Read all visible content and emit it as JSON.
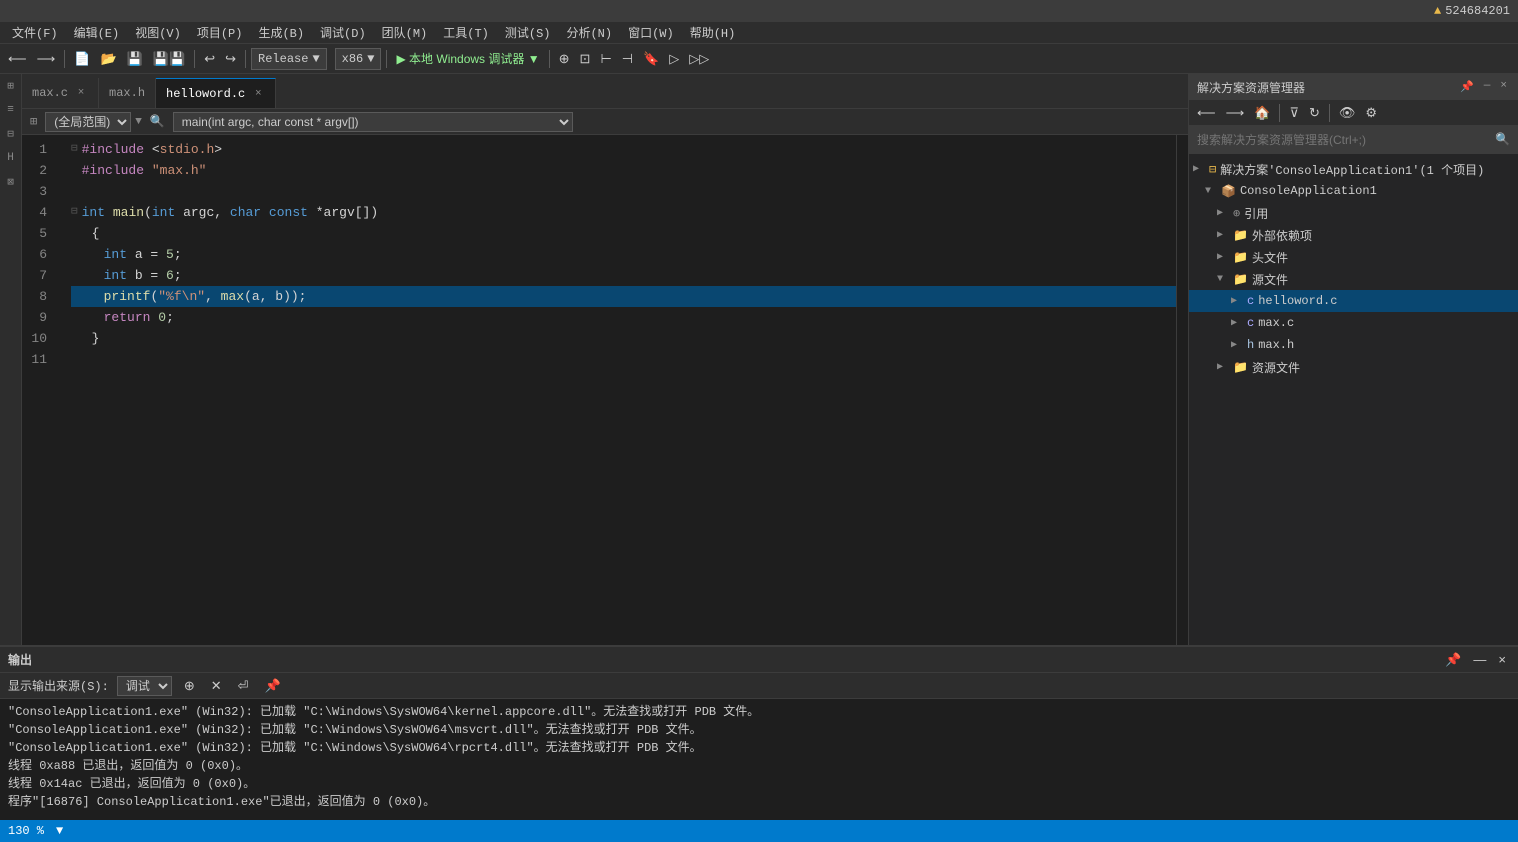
{
  "titlebar": {
    "warning": "▲",
    "id": "524684201"
  },
  "menubar": {
    "items": [
      "文件(F)",
      "编辑(E)",
      "视图(V)",
      "项目(P)",
      "生成(B)",
      "调试(D)",
      "团队(M)",
      "工具(T)",
      "测试(S)",
      "分析(N)",
      "窗口(W)",
      "帮助(H)"
    ]
  },
  "toolbar": {
    "config_label": "Release",
    "platform_label": "x86",
    "run_label": "▶ 本地 Windows 调试器 ▼"
  },
  "tabs": [
    {
      "label": "max.c",
      "active": false,
      "closable": true
    },
    {
      "label": "max.h",
      "active": false,
      "closable": false
    },
    {
      "label": "helloword.c",
      "active": true,
      "closable": true
    }
  ],
  "navbar": {
    "scope": "(全局范围)",
    "function": "main(int argc, char const * argv[])"
  },
  "code": {
    "lines": [
      {
        "num": 1,
        "content": "#include <stdio.h>",
        "type": "include"
      },
      {
        "num": 2,
        "content": "#include \"max.h\"",
        "type": "include"
      },
      {
        "num": 3,
        "content": "",
        "type": "empty"
      },
      {
        "num": 4,
        "content": "int main(int argc, char const *argv[])",
        "type": "func"
      },
      {
        "num": 5,
        "content": "{",
        "type": "normal"
      },
      {
        "num": 6,
        "content": "    int a = 5;",
        "type": "normal"
      },
      {
        "num": 7,
        "content": "    int b = 6;",
        "type": "normal"
      },
      {
        "num": 8,
        "content": "    printf(\"%f\\n\", max(a, b));",
        "type": "active"
      },
      {
        "num": 9,
        "content": "    return 0;",
        "type": "normal"
      },
      {
        "num": 10,
        "content": "}",
        "type": "normal"
      },
      {
        "num": 11,
        "content": "",
        "type": "empty"
      }
    ]
  },
  "solution_explorer": {
    "title": "解决方案资源管理器",
    "search_placeholder": "搜索解决方案资源管理器(Ctrl+;)",
    "tree": {
      "solution_label": "解决方案'ConsoleApplication1'(1 个项目)",
      "project_label": "ConsoleApplication1",
      "items": [
        {
          "label": "引用",
          "icon": "ref",
          "indent": 2,
          "expanded": false
        },
        {
          "label": "外部依赖项",
          "icon": "dep",
          "indent": 2,
          "expanded": false
        },
        {
          "label": "头文件",
          "icon": "folder",
          "indent": 2,
          "expanded": false
        },
        {
          "label": "源文件",
          "icon": "folder",
          "indent": 2,
          "expanded": true
        },
        {
          "label": "helloword.c",
          "icon": "c-file",
          "indent": 3,
          "expanded": false,
          "selected": true
        },
        {
          "label": "max.c",
          "icon": "c-file",
          "indent": 3,
          "expanded": false
        },
        {
          "label": "max.h",
          "icon": "h-file",
          "indent": 3,
          "expanded": false
        },
        {
          "label": "资源文件",
          "icon": "folder",
          "indent": 2,
          "expanded": false
        }
      ]
    }
  },
  "bottom_panel": {
    "title": "输出",
    "source_label": "显示输出来源(S):",
    "source_value": "调试",
    "content": [
      "\"ConsoleApplication1.exe\" (Win32): 已加载 \"C:\\Windows\\SysWOW64\\kernel.appcore.dll\"。无法查找或打开 PDB 文件。",
      "\"ConsoleApplication1.exe\" (Win32): 已加载 \"C:\\Windows\\SysWOW64\\msvcrt.dll\"。无法查找或打开 PDB 文件。",
      "\"ConsoleApplication1.exe\" (Win32): 已加载 \"C:\\Windows\\SysWOW64\\rpcrt4.dll\"。无法查找或打开 PDB 文件。",
      "线程 0xa88 已退出，返回值为 0 (0x0)。",
      "线程 0x14ac 已退出，返回值为 0 (0x0)。",
      "程序\"[16876] ConsoleApplication1.exe\"已退出，返回值为 0 (0x0)。"
    ]
  },
  "status_bar": {
    "zoom": "130 %"
  }
}
